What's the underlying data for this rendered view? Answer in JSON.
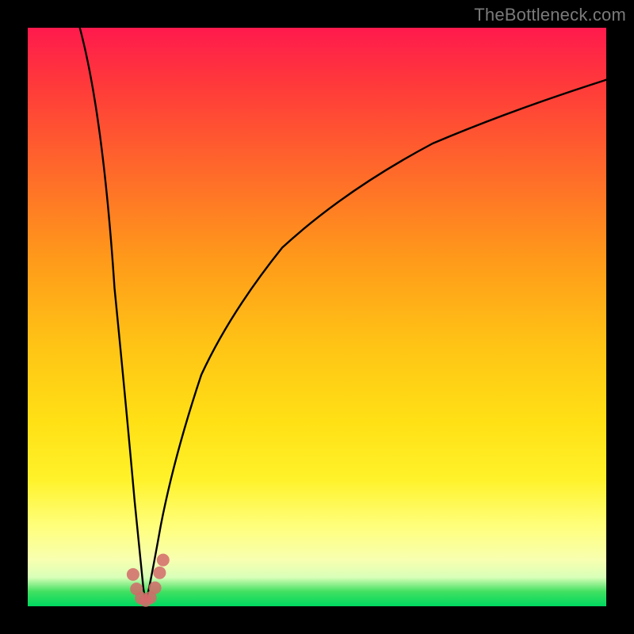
{
  "watermark": "TheBottleneck.com",
  "chart_data": {
    "type": "line",
    "title": "",
    "xlabel": "",
    "ylabel": "",
    "xlim": [
      0,
      100
    ],
    "ylim": [
      0,
      100
    ],
    "note": "V-shaped curve with a sharp minimum near x≈20; left branch descends steeply from top-left, right branch rises with decreasing slope toward upper right. Axis values are approximate as the source image has no tick labels.",
    "series": [
      {
        "name": "left-branch",
        "x": [
          9,
          12,
          15,
          17,
          18.5,
          19.5,
          20,
          20.5
        ],
        "y": [
          100,
          80,
          55,
          35,
          18,
          8,
          3,
          1
        ]
      },
      {
        "name": "right-branch",
        "x": [
          20.5,
          21.5,
          23,
          26,
          30,
          36,
          44,
          55,
          70,
          85,
          100
        ],
        "y": [
          1,
          5,
          14,
          28,
          40,
          52,
          62,
          72,
          80,
          86,
          91
        ]
      }
    ],
    "markers": {
      "name": "highlighted-points-near-minimum",
      "color": "#d46a6a",
      "x": [
        18.2,
        18.8,
        19.6,
        20.4,
        21.2,
        22.0,
        22.8,
        23.4
      ],
      "y": [
        5.5,
        3.0,
        1.4,
        1.0,
        1.5,
        3.2,
        5.8,
        8.0
      ]
    },
    "background_gradient": {
      "top": "#ff1a4d",
      "mid_upper": "#ff9a1a",
      "mid": "#ffe015",
      "mid_lower": "#ffff7a",
      "bottom": "#00d860"
    }
  }
}
